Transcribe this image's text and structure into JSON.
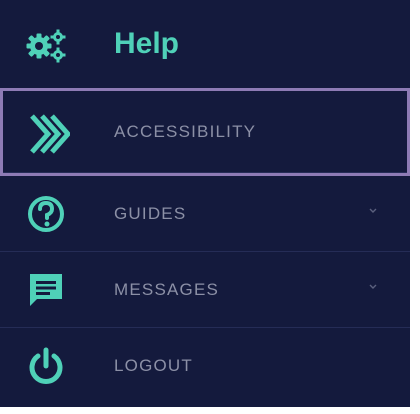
{
  "header": {
    "title": "Help",
    "icon": "gears-icon"
  },
  "items": [
    {
      "label": "ACCESSIBILITY",
      "icon": "double-chevron-right-icon",
      "active": true
    },
    {
      "label": "GUIDES",
      "icon": "question-circle-icon",
      "expandable": true
    },
    {
      "label": "MESSAGES",
      "icon": "message-icon",
      "expandable": true
    },
    {
      "label": "LOGOUT",
      "icon": "power-icon"
    }
  ],
  "colors": {
    "background": "#141a3d",
    "accent": "#4fd1b8",
    "label": "#8c90a6",
    "active_border": "#8e7bb5",
    "divider": "#252c56"
  }
}
